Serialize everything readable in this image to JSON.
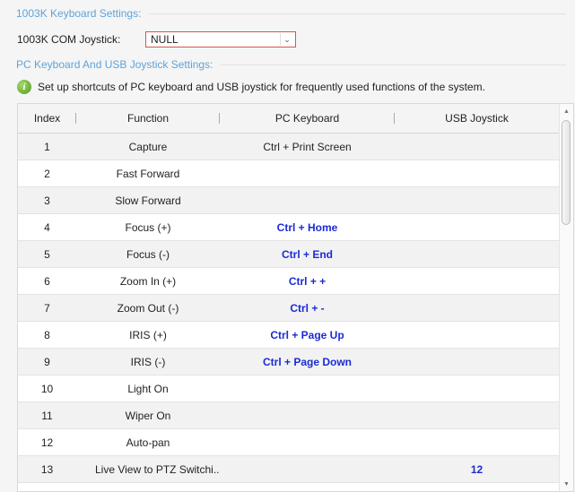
{
  "keyboard_section": {
    "title": "1003K Keyboard Settings:",
    "joystick_label": "1003K COM Joystick:",
    "joystick_value": "NULL"
  },
  "pc_section": {
    "title": "PC Keyboard And USB Joystick Settings:",
    "info_text": "Set up shortcuts of PC keyboard and USB joystick for frequently used functions of the system."
  },
  "table": {
    "headers": [
      "Index",
      "Function",
      "PC Keyboard",
      "USB Joystick"
    ],
    "rows": [
      {
        "index": "1",
        "function": "Capture",
        "pc_keyboard": "Ctrl + Print Screen",
        "usb_joystick": "",
        "custom": false
      },
      {
        "index": "2",
        "function": "Fast Forward",
        "pc_keyboard": "",
        "usb_joystick": "",
        "custom": false
      },
      {
        "index": "3",
        "function": "Slow Forward",
        "pc_keyboard": "",
        "usb_joystick": "",
        "custom": false
      },
      {
        "index": "4",
        "function": "Focus (+)",
        "pc_keyboard": "Ctrl + Home",
        "usb_joystick": "",
        "custom": true
      },
      {
        "index": "5",
        "function": "Focus (-)",
        "pc_keyboard": "Ctrl + End",
        "usb_joystick": "",
        "custom": true
      },
      {
        "index": "6",
        "function": "Zoom In (+)",
        "pc_keyboard": "Ctrl + +",
        "usb_joystick": "",
        "custom": true
      },
      {
        "index": "7",
        "function": "Zoom Out (-)",
        "pc_keyboard": "Ctrl + -",
        "usb_joystick": "",
        "custom": true
      },
      {
        "index": "8",
        "function": "IRIS (+)",
        "pc_keyboard": "Ctrl + Page Up",
        "usb_joystick": "",
        "custom": true
      },
      {
        "index": "9",
        "function": "IRIS (-)",
        "pc_keyboard": "Ctrl + Page Down",
        "usb_joystick": "",
        "custom": true
      },
      {
        "index": "10",
        "function": "Light On",
        "pc_keyboard": "",
        "usb_joystick": "",
        "custom": false
      },
      {
        "index": "11",
        "function": "Wiper On",
        "pc_keyboard": "",
        "usb_joystick": "",
        "custom": false
      },
      {
        "index": "12",
        "function": "Auto-pan",
        "pc_keyboard": "",
        "usb_joystick": "",
        "custom": false
      },
      {
        "index": "13",
        "function": "Live View to PTZ Switchi...",
        "pc_keyboard": "",
        "usb_joystick": "12",
        "custom": true
      }
    ]
  },
  "colors": {
    "section_title": "#5fa3d8",
    "custom_shortcut": "#1a2bd6",
    "select_border": "#d9534f",
    "info_icon": "#4e9a1e"
  },
  "icons": {
    "info": "info-icon",
    "dropdown": "chevron-down-icon"
  },
  "glyphs": {
    "info": "i",
    "dropdown": "⌄",
    "scroll_up": "▲",
    "scroll_down": "▼"
  }
}
